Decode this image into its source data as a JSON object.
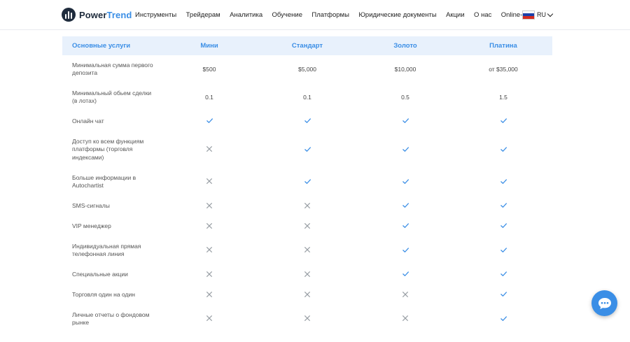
{
  "header": {
    "logo": {
      "brand_a": "Power",
      "brand_b": "Trend"
    },
    "nav": [
      "Инструменты",
      "Трейдерам",
      "Аналитика",
      "Обучение",
      "Платформы",
      "Юридические документы",
      "Акции",
      "О нас",
      "Online-TV"
    ],
    "lang": {
      "code": "RU",
      "icon": "russia-flag-icon"
    }
  },
  "table": {
    "headers": [
      "Основные услуги",
      "Мини",
      "Стандарт",
      "Золото",
      "Платина"
    ],
    "rows": [
      {
        "label": "Минимальная сумма первого депозита",
        "cells": [
          "$500",
          "$5,000",
          "$10,000",
          "от $35,000"
        ]
      },
      {
        "label": "Минимальный обьем сделки (в лотах)",
        "cells": [
          "0.1",
          "0.1",
          "0.5",
          "1.5"
        ]
      },
      {
        "label": "Онлайн чат",
        "cells": [
          "check",
          "check",
          "check",
          "check"
        ]
      },
      {
        "label": "Доступ ко всем функциям платформы (торговля индексами)",
        "cells": [
          "cross",
          "check",
          "check",
          "check"
        ]
      },
      {
        "label": "Больше информации в Autochartist",
        "cells": [
          "cross",
          "check",
          "check",
          "check"
        ]
      },
      {
        "label": "SMS-сигналы",
        "cells": [
          "cross",
          "cross",
          "check",
          "check"
        ]
      },
      {
        "label": "VIP менеджер",
        "cells": [
          "cross",
          "cross",
          "check",
          "check"
        ]
      },
      {
        "label": "Индивидуальная прямая телефонная линия",
        "cells": [
          "cross",
          "cross",
          "check",
          "check"
        ]
      },
      {
        "label": "Специальные акции",
        "cells": [
          "cross",
          "cross",
          "check",
          "check"
        ]
      },
      {
        "label": "Торговля один на один",
        "cells": [
          "cross",
          "cross",
          "cross",
          "check"
        ]
      },
      {
        "label": "Личные отчеты о фондовом рынке",
        "cells": [
          "cross",
          "cross",
          "cross",
          "check"
        ]
      }
    ]
  },
  "colors": {
    "accent": "#3a8ee6",
    "header_bg": "#e8f1fc",
    "check": "#3a8ee6",
    "cross": "#9aa0a6",
    "dark": "#1e2b3c"
  },
  "chat_button": {
    "icon": "chat-bubble-icon"
  }
}
